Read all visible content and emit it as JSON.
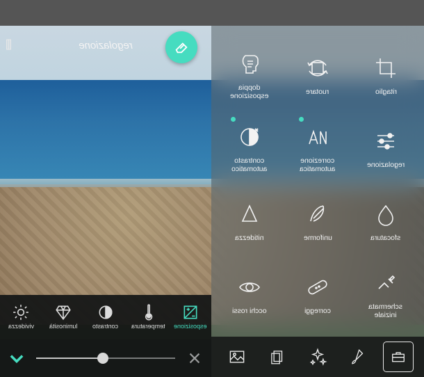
{
  "colors": {
    "accent": "#46dcc0"
  },
  "header": {
    "title": "regolazione",
    "eraser": "eraser-icon"
  },
  "tooltabs": [
    {
      "label": "vividezza",
      "icon": "sun"
    },
    {
      "label": "luminosità",
      "icon": "diamond"
    },
    {
      "label": "contrasto",
      "icon": "halfcircle"
    },
    {
      "label": "temperatura",
      "icon": "thermo"
    },
    {
      "label": "esposizione",
      "icon": "exposure",
      "active": true
    }
  ],
  "slider": {
    "value": 48
  },
  "toolgrid": [
    {
      "label": "doppia\nesposizione",
      "icon": "head"
    },
    {
      "label": "ruotare",
      "icon": "rotate"
    },
    {
      "label": "ritaglio",
      "icon": "crop"
    },
    {
      "label": "contrasto\nautomatico",
      "icon": "autocontrast",
      "dot": true
    },
    {
      "label": "correzione\nautomatica",
      "icon": "autofix",
      "dot": true
    },
    {
      "label": "regolazione",
      "icon": "sliders"
    },
    {
      "label": "nitidezza",
      "icon": "sharpen"
    },
    {
      "label": "uniforme",
      "icon": "feather"
    },
    {
      "label": "sfocatura",
      "icon": "drop"
    },
    {
      "label": "occhi rossi",
      "icon": "eye"
    },
    {
      "label": "correggi",
      "icon": "bandage"
    },
    {
      "label": "schermata\niniziale",
      "icon": "splash"
    }
  ],
  "bottomnav": [
    {
      "name": "image",
      "icon": "image"
    },
    {
      "name": "layers",
      "icon": "layers"
    },
    {
      "name": "magic",
      "icon": "magic"
    },
    {
      "name": "brush",
      "icon": "brush"
    },
    {
      "name": "toolbox",
      "icon": "toolbox",
      "active": true
    }
  ]
}
